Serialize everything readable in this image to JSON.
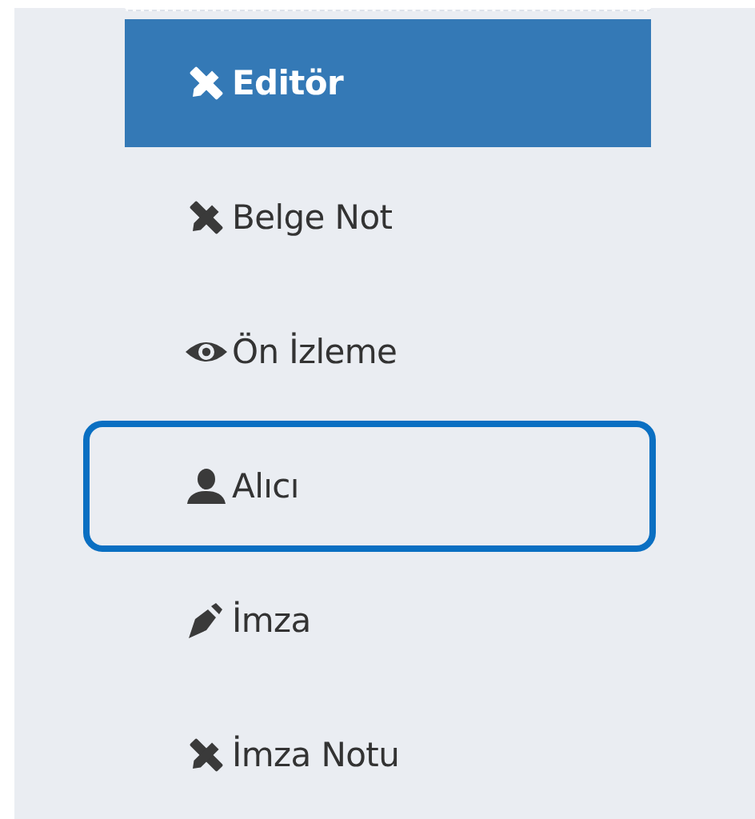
{
  "menu": {
    "items": [
      {
        "label": "Editör",
        "selected": true,
        "focused": false
      },
      {
        "label": "Belge Not",
        "selected": false,
        "focused": false
      },
      {
        "label": "Ön İzleme",
        "selected": false,
        "focused": false
      },
      {
        "label": "Alıcı",
        "selected": false,
        "focused": true
      },
      {
        "label": "İmza",
        "selected": false,
        "focused": false
      },
      {
        "label": "İmza Notu",
        "selected": false,
        "focused": false
      }
    ]
  }
}
